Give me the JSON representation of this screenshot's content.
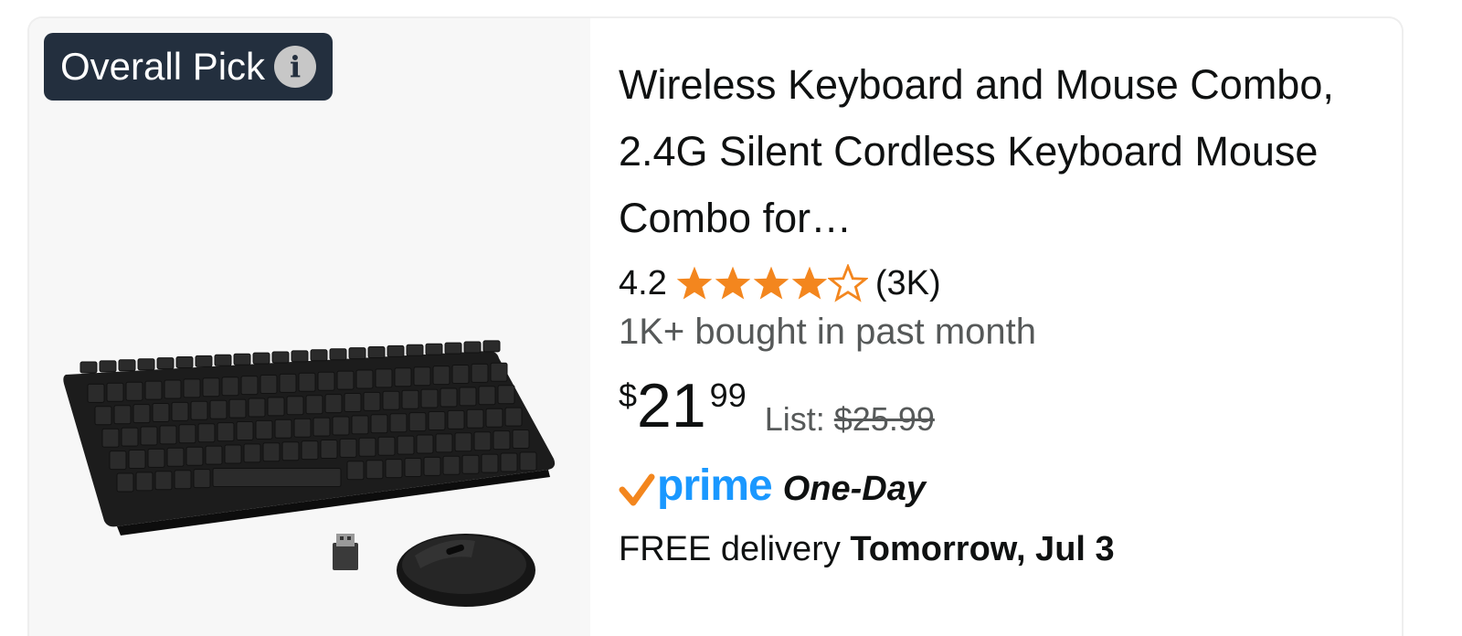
{
  "badge": {
    "label": "Overall Pick",
    "icon": "info-icon"
  },
  "product": {
    "title": "Wireless Keyboard and Mouse Combo, 2.4G Silent Cordless Keyboard Mouse Combo for…",
    "rating": {
      "value": "4.2",
      "stars": 4.2,
      "count": "(3K)",
      "star_color": "#f3861e"
    },
    "bought": "1K+ bought in past month",
    "price": {
      "symbol": "$",
      "whole": "21",
      "fraction": "99"
    },
    "list_price": {
      "label": "List:",
      "value": "$25.99"
    },
    "prime": {
      "word": "prime",
      "speed": "One-Day",
      "check_color": "#f3861e",
      "word_color": "#1a98ff"
    },
    "delivery": {
      "prefix": "FREE delivery",
      "date": "Tomorrow, Jul 3"
    }
  }
}
